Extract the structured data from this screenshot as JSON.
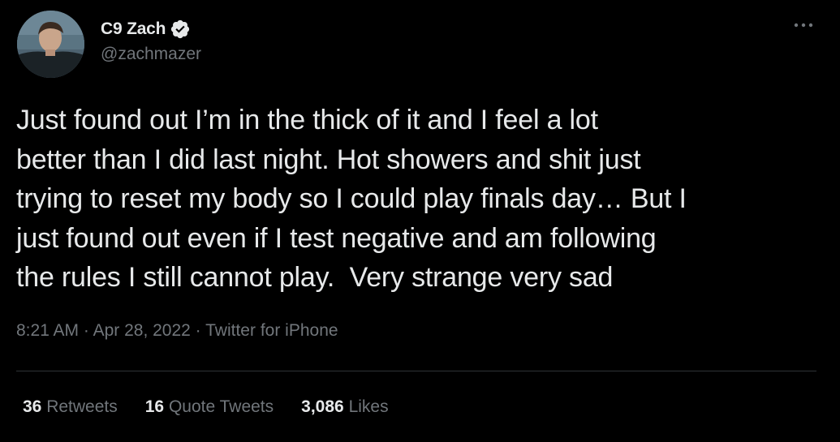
{
  "author": {
    "display_name": "C9 Zach",
    "handle": "@zachmazer",
    "verified": true
  },
  "tweet": {
    "text": "Just found out I’m in the thick of it and I feel a lot\nbetter than I did last night. Hot showers and shit just\ntrying to reset my body so I could play finals day… But I\njust found out even if I test negative and am following\nthe rules I still cannot play.  Very strange very sad"
  },
  "meta": {
    "time": "8:21 AM",
    "separator": " · ",
    "date": "Apr 28, 2022",
    "source": "Twitter for iPhone"
  },
  "stats": {
    "retweets_count": "36",
    "retweets_label": "Retweets",
    "quotes_count": "16",
    "quotes_label": "Quote Tweets",
    "likes_count": "3,086",
    "likes_label": "Likes"
  },
  "colors": {
    "background": "#000000",
    "primary_text": "#e7e9ea",
    "secondary_text": "#71767b",
    "divider": "#2f3336",
    "verified_badge": "#e7e9ea"
  },
  "icons": {
    "verified": "verified-badge-icon",
    "more": "more-options-icon"
  }
}
